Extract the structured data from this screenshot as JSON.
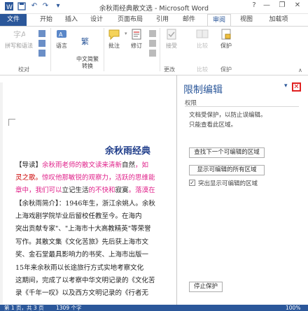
{
  "titlebar": {
    "title": "余秋雨经典散文选 - Microsoft Word",
    "help": "?",
    "minimize": "—",
    "restore": "❐",
    "close": "✕"
  },
  "quick_access": {
    "save_icon": "save-icon",
    "undo_icon": "undo-icon",
    "redo_icon": "redo-icon",
    "customize_icon": "customize-icon"
  },
  "tabs": {
    "file": "文件",
    "items": [
      "开始",
      "插入",
      "设计",
      "页面布局",
      "引用",
      "邮件",
      "审阅",
      "视图",
      "加载项"
    ],
    "active": "审阅"
  },
  "ribbon": {
    "buttons": [
      {
        "label": "拼写和语法",
        "icon": "spelling-icon"
      },
      {
        "label": "语言",
        "icon": "language-icon"
      },
      {
        "label": "中文简繁\n转换",
        "icon": "chinese-convert-icon"
      },
      {
        "label": "批注",
        "icon": "comment-icon"
      },
      {
        "label": "修订",
        "icon": "track-changes-icon"
      },
      {
        "label": "接受",
        "icon": "accept-icon"
      },
      {
        "label": "比较",
        "icon": "compare-icon"
      },
      {
        "label": "保护",
        "icon": "protect-icon"
      }
    ],
    "groups": [
      "校对",
      "更改",
      "比较",
      "保护"
    ]
  },
  "document": {
    "title": "余秋雨经典",
    "lines": [
      {
        "parts": [
          {
            "t": "【导读】",
            "c": ""
          },
          {
            "t": "余秋雨老师的散文读来清新",
            "c": "pink"
          },
          {
            "t": "自然",
            "c": ""
          },
          {
            "t": "，如",
            "c": "pink"
          }
        ]
      },
      {
        "parts": [
          {
            "t": "灵之歌。",
            "c": "red"
          },
          {
            "t": "惊叹他那敏锐的观察力，活跃的思维能",
            "c": "pink"
          }
        ]
      },
      {
        "parts": [
          {
            "t": "章中，我们可以",
            "c": "pink"
          },
          {
            "t": "立记生活",
            "c": ""
          },
          {
            "t": "的不快和",
            "c": "pink"
          },
          {
            "t": "寂寞",
            "c": ""
          },
          {
            "t": "。落漠在",
            "c": "pink"
          }
        ]
      },
      {
        "parts": [
          {
            "t": "【余秋雨简介】：1946年生，浙江余姚人。余秋",
            "c": ""
          }
        ]
      },
      {
        "parts": [
          {
            "t": "上海戏剧学院毕业后留校任教至今。在海内",
            "c": ""
          }
        ]
      },
      {
        "parts": [
          {
            "t": "突出贡献专家\"、\"上海市十大高教精英\"等荣誉",
            "c": ""
          }
        ]
      },
      {
        "parts": [
          {
            "t": "写作。其散文集《文化苦旅》先后获上海市文",
            "c": ""
          }
        ]
      },
      {
        "parts": [
          {
            "t": "奖、金石堂最具影响力的书奖、上海市出版一",
            "c": ""
          }
        ]
      },
      {
        "parts": [
          {
            "t": "    15年来余秋雨以长途旅行方式实地考察文化",
            "c": ""
          }
        ]
      },
      {
        "parts": [
          {
            "t": "这期间，完成了以考察中华文明记录的《文化苦",
            "c": ""
          }
        ]
      },
      {
        "parts": [
          {
            "t": "录《千年一叹》以及西方文明记录的《行者无",
            "c": ""
          }
        ]
      }
    ]
  },
  "pane": {
    "title": "限制编辑",
    "section": "权限",
    "desc1": "文档受保护，以防止误编辑。",
    "desc2": "只能查看此区域。",
    "btn_next": "查找下一个可编辑的区域",
    "btn_all": "显示可编辑的所有区域",
    "checkbox_label": "突出显示可编辑的区域",
    "checkbox_checked": true,
    "btn_stop": "停止保护"
  },
  "status": {
    "page": "第 1 页，共 3 页",
    "words": "1309 个字",
    "zoom": "100%"
  },
  "colors": {
    "accent": "#2b579a",
    "pink_text": "#e0218a",
    "close_highlight": "#e02020"
  }
}
